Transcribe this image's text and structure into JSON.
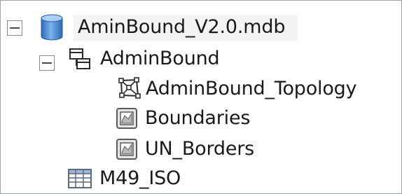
{
  "tree": {
    "root": {
      "label": "AminBound_V2.0.mdb",
      "icon": "database-icon",
      "expanded": true
    },
    "dataset": {
      "label": "AdminBound",
      "icon": "feature-dataset-icon",
      "expanded": true
    },
    "items": [
      {
        "label": "AdminBound_Topology",
        "icon": "topology-icon"
      },
      {
        "label": "Boundaries",
        "icon": "polygon-feature-class-icon"
      },
      {
        "label": "UN_Borders",
        "icon": "polygon-feature-class-icon"
      }
    ],
    "table": {
      "label": "M49_ISO",
      "icon": "table-icon"
    }
  },
  "colors": {
    "database_blue": "#4f8fd8",
    "database_dark": "#2d6bb8",
    "expander_border": "#8a8a8a",
    "frame_border": "#9aa5b8"
  }
}
